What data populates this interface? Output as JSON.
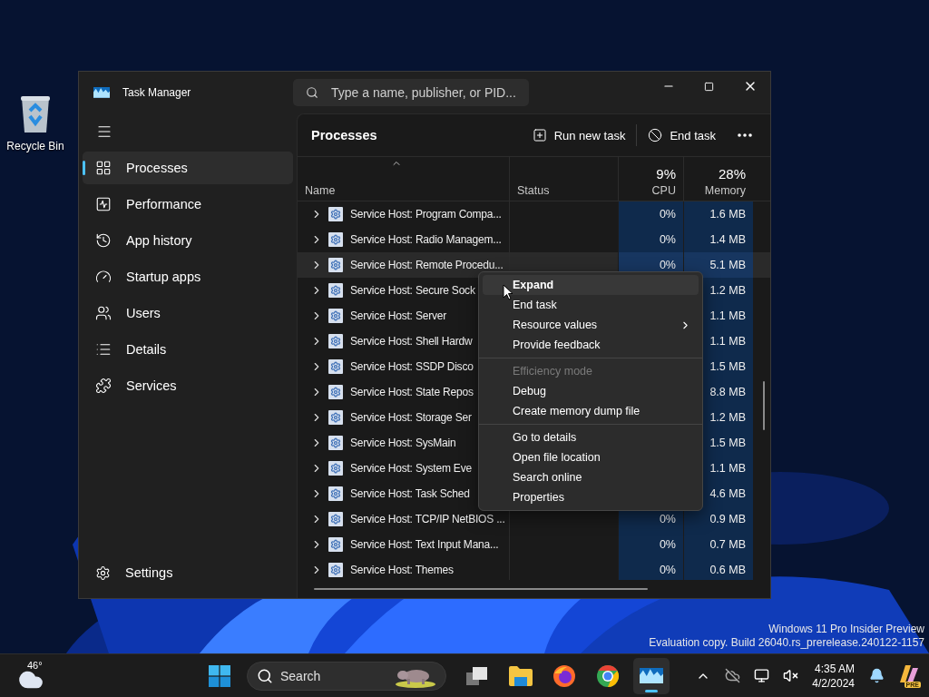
{
  "desktop": {
    "icons": [
      {
        "label": "Recycle Bin"
      }
    ],
    "build_info": [
      "Windows 11 Pro Insider Preview",
      "Evaluation copy. Build 26040.rs_prerelease.240122-1157"
    ]
  },
  "window": {
    "title": "Task Manager",
    "search": {
      "placeholder": "Type a name, publisher, or PID..."
    }
  },
  "sidebar": {
    "items": [
      {
        "label": "Processes",
        "selected": true
      },
      {
        "label": "Performance",
        "selected": false
      },
      {
        "label": "App history",
        "selected": false
      },
      {
        "label": "Startup apps",
        "selected": false
      },
      {
        "label": "Users",
        "selected": false
      },
      {
        "label": "Details",
        "selected": false
      },
      {
        "label": "Services",
        "selected": false
      }
    ],
    "settings": "Settings"
  },
  "page": {
    "title": "Processes",
    "actions": [
      "Run new task",
      "End task"
    ]
  },
  "table": {
    "summary": {
      "cpu": "9%",
      "memory": "28%"
    },
    "columns": [
      "Name",
      "Status",
      "CPU",
      "Memory"
    ],
    "rows": [
      {
        "name": "Service Host: Program Compa...",
        "cpu": "0%",
        "memory": "1.6 MB",
        "selected": false
      },
      {
        "name": "Service Host: Radio Managem...",
        "cpu": "0%",
        "memory": "1.4 MB",
        "selected": false
      },
      {
        "name": "Service Host: Remote Procedu...",
        "cpu": "0%",
        "memory": "5.1 MB",
        "selected": true
      },
      {
        "name": "Service Host: Secure Sock",
        "memory": "1.2 MB",
        "selected": false
      },
      {
        "name": "Service Host: Server",
        "memory": "1.1 MB",
        "selected": false
      },
      {
        "name": "Service Host: Shell Hardw",
        "memory": "1.1 MB",
        "selected": false
      },
      {
        "name": "Service Host: SSDP Disco",
        "memory": "1.5 MB",
        "selected": false
      },
      {
        "name": "Service Host: State Repos",
        "memory": "8.8 MB",
        "selected": false
      },
      {
        "name": "Service Host: Storage Ser",
        "memory": "1.2 MB",
        "selected": false
      },
      {
        "name": "Service Host: SysMain",
        "memory": "1.5 MB",
        "selected": false
      },
      {
        "name": "Service Host: System Eve",
        "memory": "1.1 MB",
        "selected": false
      },
      {
        "name": "Service Host: Task Sched",
        "memory": "4.6 MB",
        "selected": false
      },
      {
        "name": "Service Host: TCP/IP NetBIOS ...",
        "cpu": "0%",
        "memory": "0.9 MB",
        "selected": false
      },
      {
        "name": "Service Host: Text Input Mana...",
        "cpu": "0%",
        "memory": "0.7 MB",
        "selected": false
      },
      {
        "name": "Service Host: Themes",
        "cpu": "0%",
        "memory": "0.6 MB",
        "selected": false
      }
    ]
  },
  "context_menu": {
    "groups": [
      [
        {
          "label": "Expand",
          "highlighted": true,
          "disabled": false,
          "submenu": false
        },
        {
          "label": "End task",
          "highlighted": false,
          "disabled": false,
          "submenu": false
        },
        {
          "label": "Resource values",
          "highlighted": false,
          "disabled": false,
          "submenu": true
        },
        {
          "label": "Provide feedback",
          "highlighted": false,
          "disabled": false,
          "submenu": false
        }
      ],
      [
        {
          "label": "Efficiency mode",
          "highlighted": false,
          "disabled": true,
          "submenu": false
        },
        {
          "label": "Debug",
          "highlighted": false,
          "disabled": false,
          "submenu": false
        },
        {
          "label": "Create memory dump file",
          "highlighted": false,
          "disabled": false,
          "submenu": false
        }
      ],
      [
        {
          "label": "Go to details",
          "highlighted": false,
          "disabled": false,
          "submenu": false
        },
        {
          "label": "Open file location",
          "highlighted": false,
          "disabled": false,
          "submenu": false
        },
        {
          "label": "Search online",
          "highlighted": false,
          "disabled": false,
          "submenu": false
        },
        {
          "label": "Properties",
          "highlighted": false,
          "disabled": false,
          "submenu": false
        }
      ]
    ]
  },
  "taskbar": {
    "weather": "46°",
    "search_label": "Search",
    "apps": [
      {
        "kind": "task-view",
        "active": false
      },
      {
        "kind": "explorer",
        "active": false
      },
      {
        "kind": "firefox",
        "active": false
      },
      {
        "kind": "chrome",
        "active": false
      },
      {
        "kind": "task-manager",
        "active": true
      }
    ],
    "clock": {
      "time": "4:35 AM",
      "date": "4/2/2024"
    },
    "copilot_badge": "PRE"
  }
}
